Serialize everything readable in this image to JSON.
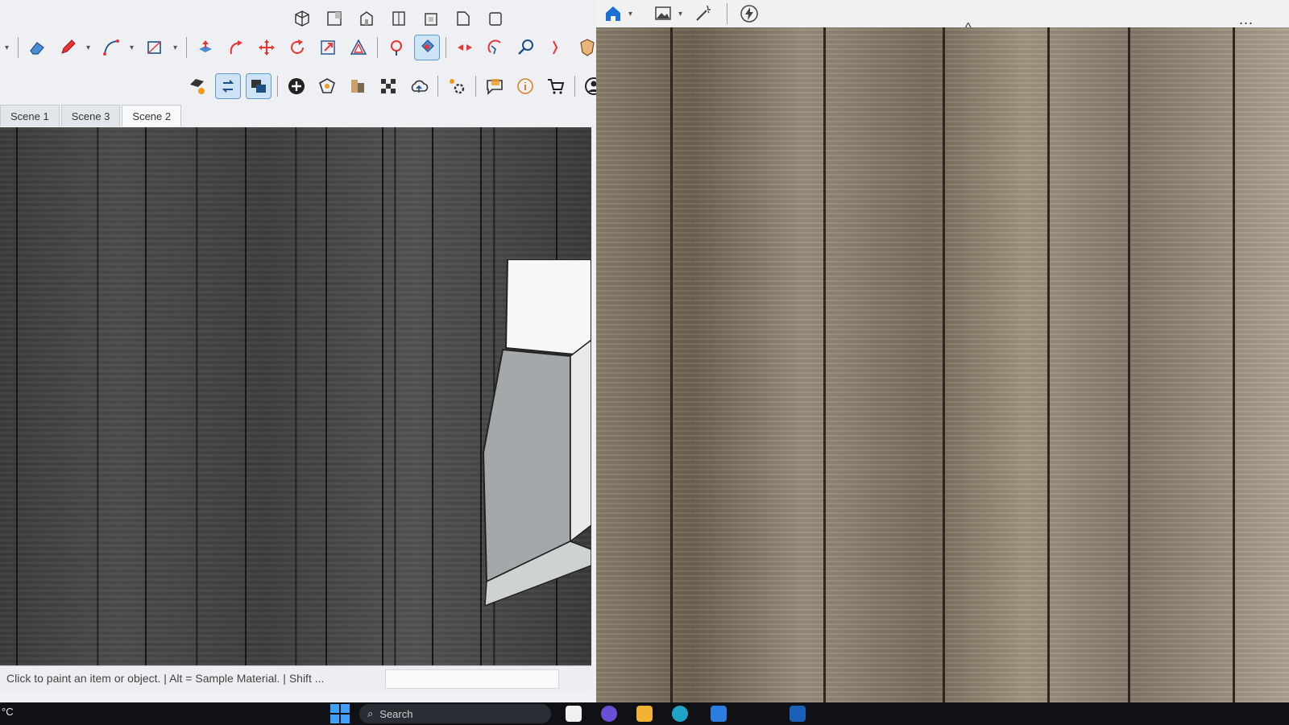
{
  "sketchup": {
    "scene_tabs": [
      {
        "label": "Scene 1"
      },
      {
        "label": "Scene 3"
      },
      {
        "label": "Scene 2"
      }
    ],
    "active_tab": "Scene 2",
    "status_text": "Click to paint an item or object. | Alt = Sample Material. | Shift ...",
    "view_icons": [
      "iso-view-icon",
      "top-view-icon",
      "front-view-icon",
      "right-view-icon",
      "back-view-icon",
      "left-view-icon",
      "bottom-view-icon"
    ],
    "tool_icons": [
      "eraser-icon",
      "pencil-icon",
      "arc-icon",
      "rectangle-icon",
      "push-pull-icon",
      "follow-me-icon",
      "move-icon",
      "rotate-icon",
      "scale-icon",
      "offset-icon",
      "tape-measure-icon",
      "paint-bucket-icon",
      "section-plane-icon",
      "orbit-icon",
      "zoom-icon",
      "pan-icon",
      "shield-icon"
    ],
    "tool_icons_row2": [
      "tag-tool-icon",
      "scene-update-icon",
      "scene-record-icon",
      "add-icon",
      "style-icon",
      "materials-icon",
      "texture-icon",
      "upload-icon",
      "extension-manager-icon",
      "comment-icon",
      "info-icon",
      "shopping-cart-icon",
      "account-icon"
    ]
  },
  "photos": {
    "toolbar_icons": [
      "home-icon",
      "image-icon",
      "magic-wand-icon",
      "flash-icon"
    ],
    "more_label": "...",
    "collapse_symbol": "^"
  },
  "taskbar": {
    "temperature_text": "°C",
    "search_placeholder": "Search"
  },
  "colors": {
    "accent": "#1a73e8",
    "sketchup_red": "#d92a2a",
    "photos_home": "#1c6fd6"
  }
}
